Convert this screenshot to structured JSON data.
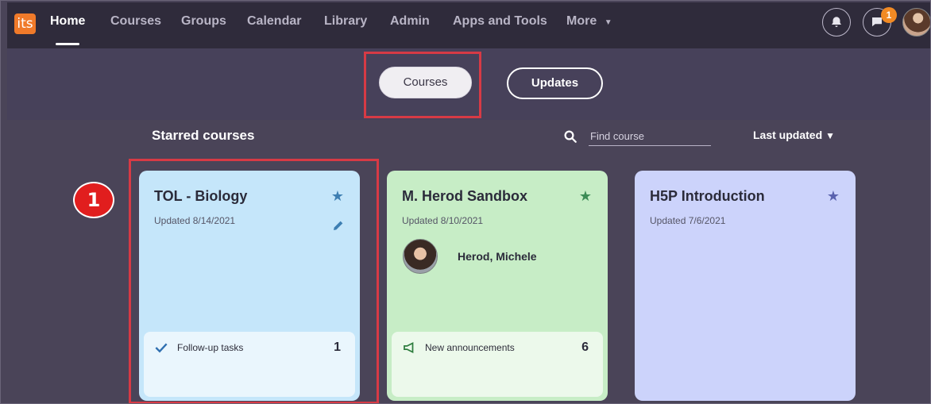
{
  "nav": {
    "logo_text": "its",
    "items": [
      {
        "label": "Home",
        "active": true
      },
      {
        "label": "Courses"
      },
      {
        "label": "Groups"
      },
      {
        "label": "Calendar"
      },
      {
        "label": "Library"
      },
      {
        "label": "Admin"
      },
      {
        "label": "Apps and Tools"
      },
      {
        "label": "More"
      }
    ],
    "messages_badge": "1"
  },
  "toggle": {
    "courses_label": "Courses",
    "updates_label": "Updates"
  },
  "section": {
    "title": "Starred courses",
    "search_placeholder": "Find course",
    "sort_label": "Last updated"
  },
  "cards": [
    {
      "title": "TOL - Biology",
      "updated": "Updated 8/14/2021",
      "footer_label": "Follow-up tasks",
      "footer_count": "1",
      "color": "#c5e6fa",
      "star_color": "#3e7fb2"
    },
    {
      "title": "M. Herod Sandbox",
      "updated": "Updated 8/10/2021",
      "instructor": "Herod, Michele",
      "footer_label": "New announcements",
      "footer_count": "6",
      "color": "#c7edc6",
      "star_color": "#3c8c56"
    },
    {
      "title": "H5P Introduction",
      "updated": "Updated 7/6/2021",
      "color": "#ccd3fb",
      "star_color": "#5a62ae"
    }
  ],
  "step_badge": "1",
  "colors": {
    "nav_bg": "#2f2b3b",
    "page_bg": "#4a4458",
    "highlight": "#d73a45",
    "badge_orange": "#f28a24"
  }
}
